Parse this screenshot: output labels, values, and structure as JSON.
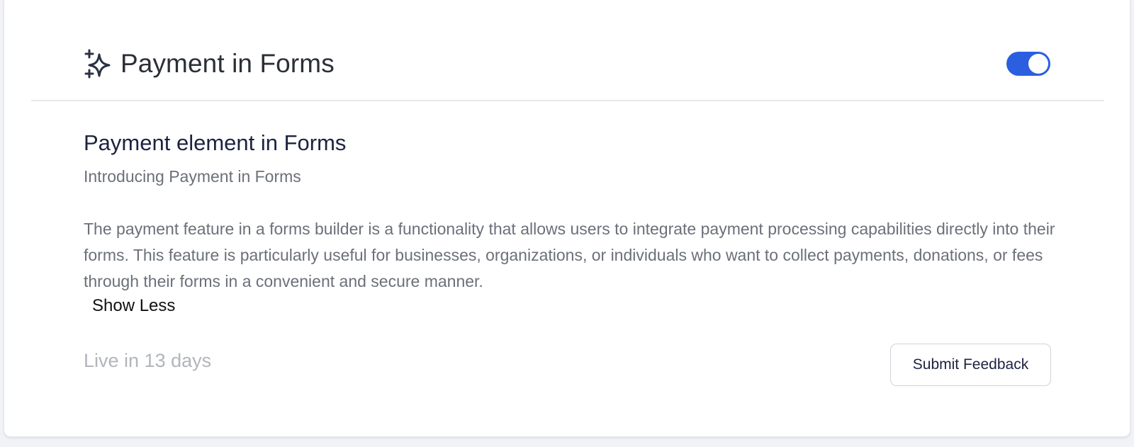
{
  "header": {
    "title": "Payment in Forms",
    "icon": "sparkle-icon",
    "toggle_on": true
  },
  "feature": {
    "title": "Payment element in Forms",
    "subtitle": "Introducing Payment in Forms",
    "description": "The payment feature in a forms builder is a functionality that allows users to integrate payment processing capabilities directly into their forms. This feature is particularly useful for businesses, organizations, or individuals who want to collect payments, donations, or fees through their forms in a convenient and secure manner.",
    "show_less_label": "Show Less"
  },
  "footer": {
    "live_status": "Live in 13 days",
    "feedback_label": "Submit Feedback"
  },
  "colors": {
    "accent": "#2b5fe0",
    "title": "#1c2340",
    "muted": "#6b7079"
  }
}
